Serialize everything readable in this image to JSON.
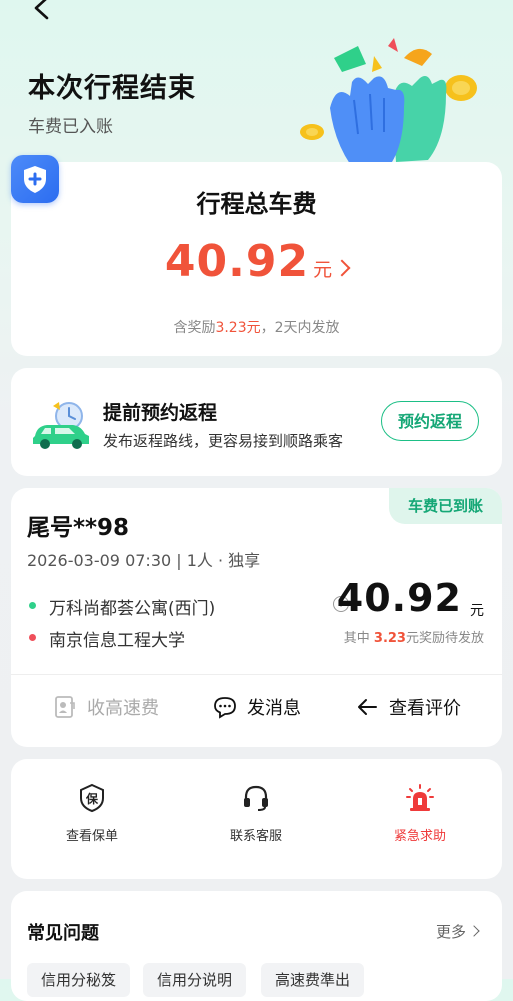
{
  "header": {
    "title": "本次行程结束",
    "subtitle": "车费已入账"
  },
  "fare": {
    "title": "行程总车费",
    "amount": "40.92",
    "unit": "元",
    "note_prefix": "含奖励",
    "note_reward": "3.23元",
    "note_suffix": "，2天内发放"
  },
  "return_trip": {
    "title": "提前预约返程",
    "desc": "发布返程路线，更容易接到顺路乘客",
    "button": "预约返程"
  },
  "trip": {
    "badge": "车费已到账",
    "plate": "尾号**98",
    "meta": "2026-03-09 07:30 | 1人 · 独享",
    "from": "万科尚都荟公寓(西门)",
    "to": "南京信息工程大学",
    "amount": "40.92",
    "unit": "元",
    "note_prefix": "其中",
    "note_reward": "3.23",
    "note_suffix": "元奖励待发放",
    "actions": {
      "toll": "收高速费",
      "message": "发消息",
      "review": "查看评价"
    }
  },
  "tools": {
    "policy": "查看保单",
    "service": "联系客服",
    "emergency": "紧急求助"
  },
  "faq": {
    "title": "常见问题",
    "more": "更多",
    "chips": [
      "信用分秘笈",
      "信用分说明",
      "高速费準出"
    ]
  },
  "colors": {
    "accent_green": "#1dbf86",
    "price_red": "#f0533a",
    "shield_blue": "#2c6df0"
  }
}
